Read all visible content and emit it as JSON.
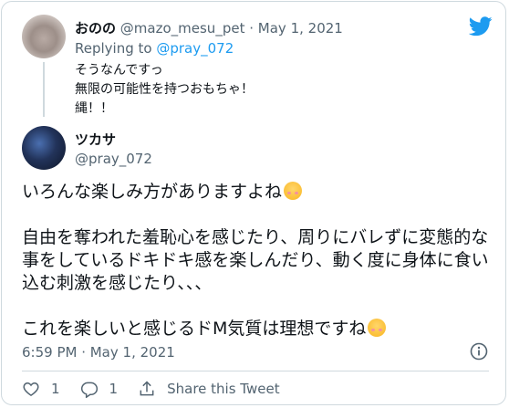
{
  "parent": {
    "name": "おのの",
    "handle": "@mazo_mesu_pet",
    "separator": "·",
    "date": "May 1, 2021",
    "replying_prefix": "Replying to",
    "replying_to": "@pray_072",
    "lines": [
      "そうなんですっ",
      "無限の可能性を持つおもちゃ！",
      "縄！！"
    ]
  },
  "main": {
    "name": "ツカサ",
    "handle": "@pray_072",
    "paragraphs": [
      [
        "いろんな楽しみ方がありますよね"
      ],
      [
        "自由を奪われた羞恥心を感じたり、周りにバレずに変態的な",
        "事をしているドキドキ感を楽しんだり、動く度に身体に食い",
        "込む刺激を感じたり、、、"
      ],
      [
        "これを楽しいと感じるドM気質は理想ですね"
      ]
    ],
    "timestamp": "6:59 PM · May 1, 2021"
  },
  "actions": {
    "likes": "1",
    "replies": "1",
    "share_label": "Share this Tweet"
  },
  "colors": {
    "twitter_blue": "#1d9bf0",
    "text": "#0f1419",
    "secondary": "#536471",
    "border": "#cfd9de"
  },
  "icons": [
    "twitter-bird-icon",
    "heart-icon",
    "reply-icon",
    "share-icon",
    "info-icon",
    "smiling-face-emoji"
  ]
}
